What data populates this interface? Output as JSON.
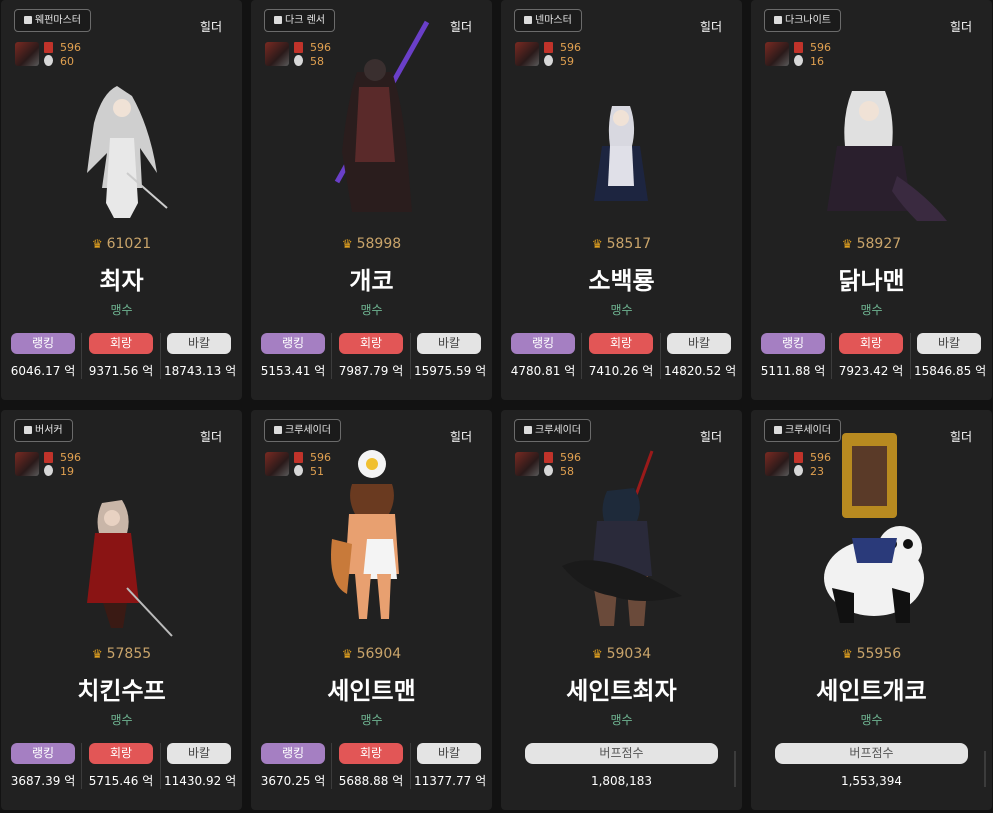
{
  "labels": {
    "server": "힐더",
    "unit": "억",
    "rank_label": "랭킹",
    "hoe_label": "회랑",
    "bakal_label": "바칼",
    "buff_label": "버프점수"
  },
  "characters": [
    {
      "job": "웨펀마스터",
      "level": "596",
      "level2": "60",
      "fame": "61021",
      "name": "최자",
      "guild": "맹수",
      "rank": "6046.17 억",
      "hoe": "9371.56 억",
      "bakal": "18743.13 억"
    },
    {
      "job": "다크 렌서",
      "level": "596",
      "level2": "58",
      "fame": "58998",
      "name": "개코",
      "guild": "맹수",
      "rank": "5153.41 억",
      "hoe": "7987.79 억",
      "bakal": "15975.59 억"
    },
    {
      "job": "넨마스터",
      "level": "596",
      "level2": "59",
      "fame": "58517",
      "name": "소백룡",
      "guild": "맹수",
      "rank": "4780.81 억",
      "hoe": "7410.26 억",
      "bakal": "14820.52 억"
    },
    {
      "job": "다크나이트",
      "level": "596",
      "level2": "16",
      "fame": "58927",
      "name": "닭나맨",
      "guild": "맹수",
      "rank": "5111.88 억",
      "hoe": "7923.42 억",
      "bakal": "15846.85 억"
    },
    {
      "job": "버서커",
      "level": "596",
      "level2": "19",
      "fame": "57855",
      "name": "치킨수프",
      "guild": "맹수",
      "rank": "3687.39 억",
      "hoe": "5715.46 억",
      "bakal": "11430.92 억"
    },
    {
      "job": "크루세이더",
      "level": "596",
      "level2": "51",
      "fame": "56904",
      "name": "세인트맨",
      "guild": "맹수",
      "rank": "3670.25 억",
      "hoe": "5688.88 억",
      "bakal": "11377.77 억"
    },
    {
      "job": "크루세이더",
      "level": "596",
      "level2": "58",
      "fame": "59034",
      "name": "세인트최자",
      "guild": "맹수",
      "buff": "1,808,183"
    },
    {
      "job": "크루세이더",
      "level": "596",
      "level2": "23",
      "fame": "55956",
      "name": "세인트개코",
      "guild": "맹수",
      "buff": "1,553,394"
    }
  ],
  "colors": {
    "rank_pill": "#a57fc2",
    "hoe_pill": "#e25656",
    "bakal_pill": "#e4e4e4",
    "guild_text": "#6fb592",
    "fame_text": "#c9a46a",
    "level_text": "#e0a050"
  },
  "icons": {
    "job_badge": "character-icon",
    "fame": "fame-crown-icon",
    "rank_item": "red-banner-icon"
  }
}
